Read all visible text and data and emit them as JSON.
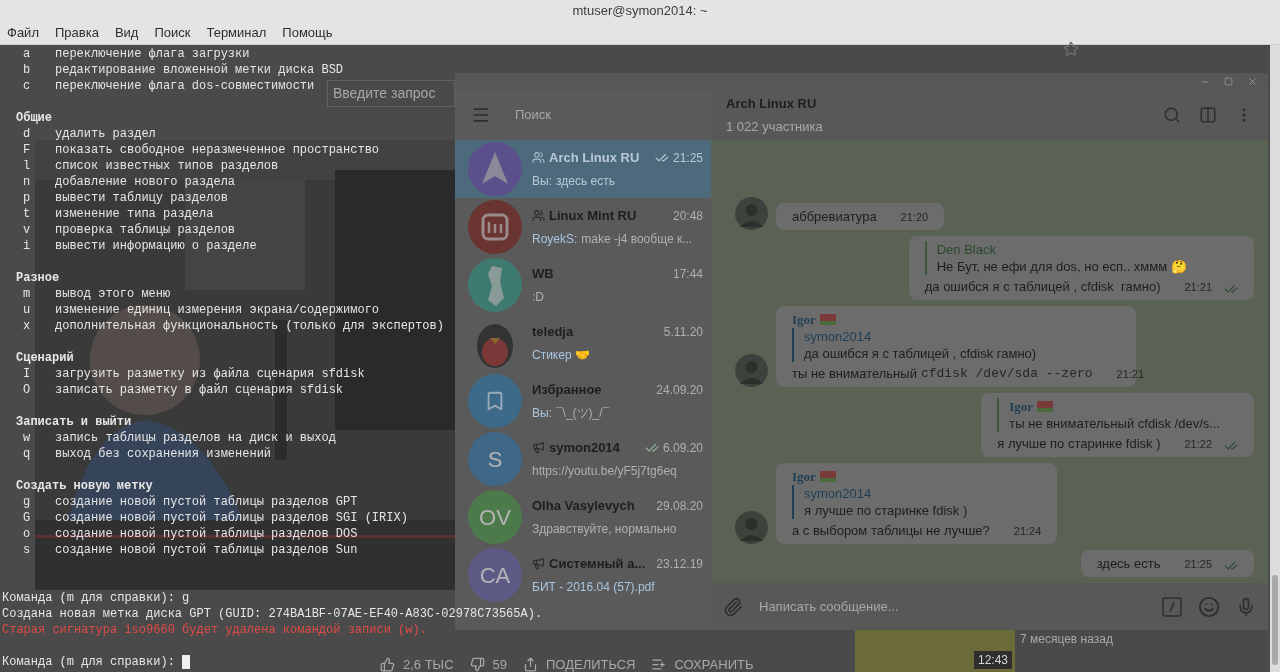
{
  "window": {
    "title": "mtuser@symon2014: ~"
  },
  "menu": [
    "Файл",
    "Правка",
    "Вид",
    "Поиск",
    "Терминал",
    "Помощь"
  ],
  "browser": {
    "search_placeholder": "Введите запрос",
    "actions": [
      {
        "kind": "like",
        "label": "2,6 ТЫС"
      },
      {
        "kind": "dislike",
        "label": "59"
      },
      {
        "kind": "share",
        "label": "ПОДЕЛИТЬСЯ"
      },
      {
        "kind": "save",
        "label": "СОХРАНИТЬ"
      }
    ],
    "thumb_duration": "12:43",
    "thumb_age": "7 месяцев назад"
  },
  "telegram": {
    "search_placeholder": "Поиск",
    "chats": [
      {
        "kind": "group",
        "name": "Arch Linux RU",
        "time": "21:25",
        "read": true,
        "prefix": "Вы:",
        "preview": "здесь есть",
        "selected": true,
        "avatar": {
          "kind": "arch",
          "color": "#5b4f8c"
        }
      },
      {
        "kind": "group",
        "name": "Linux Mint RU",
        "time": "20:48",
        "prefix": "RoyekS:",
        "preview": "make -j4 вообще к...",
        "selected": false,
        "avatar": {
          "kind": "mint",
          "color": "#6a3430"
        }
      },
      {
        "kind": "private",
        "name": "WB",
        "time": "17:44",
        "preview": ":D",
        "selected": false,
        "avatar": {
          "kind": "map",
          "color": "#3f7a70"
        }
      },
      {
        "kind": "private",
        "name": "teledja",
        "time": "5.11.20",
        "preview": "Стикер 🤝",
        "accent": true,
        "selected": false,
        "avatar": {
          "kind": "penguin",
          "color": "#7a3838"
        }
      },
      {
        "kind": "private",
        "name": "Избранное",
        "time": "24.09.20",
        "prefix": "Вы:",
        "preview": "¯\\_(ツ)_/¯",
        "selected": false,
        "avatar": {
          "kind": "bookmark",
          "color": "#3e6a8a"
        }
      },
      {
        "kind": "channel",
        "name": "symon2014",
        "time": "6.09.20",
        "read": true,
        "preview": "https://youtu.be/yF5j7tg6eq",
        "selected": false,
        "avatar": {
          "kind": "initials",
          "text": "S",
          "color": "#3f6788"
        }
      },
      {
        "kind": "private",
        "name": "Olha Vasylevych",
        "time": "29.08.20",
        "preview": "Здравствуйте, нормально",
        "selected": false,
        "avatar": {
          "kind": "initials",
          "text": "OV",
          "color": "#4d7a4a"
        }
      },
      {
        "kind": "channel",
        "name": "Системный а...",
        "time": "23.12.19",
        "preview": "БИТ - 2016.04 (57).pdf",
        "accent": true,
        "selected": false,
        "avatar": {
          "kind": "initials",
          "text": "CA",
          "color": "#5e5a86"
        }
      }
    ],
    "chat": {
      "title": "Arch Linux RU",
      "subtitle": "1 022 участника",
      "input_placeholder": "Написать сообщение...",
      "messages": [
        {
          "kind": "in",
          "text": "аббревиатура",
          "time": "21:20",
          "avatar": true
        },
        {
          "kind": "out",
          "reply": {
            "author": "Den Black",
            "text": "Не Бут, не ефи для dos, но есп.. хммм 🤔"
          },
          "text": "да ошибся я с таблицей , cfdisk  гамно)",
          "time": "21:21",
          "read": true
        },
        {
          "kind": "in",
          "sender": "Igor",
          "flag": true,
          "reply": {
            "author": "symon2014",
            "text": "да ошибся я с таблицей , cfdisk  гамно)"
          },
          "text": "ты не внимательный",
          "code": "cfdisk /dev/sda --zero",
          "time": "21:21",
          "avatar": true
        },
        {
          "kind": "out",
          "reply": {
            "author": "Igor",
            "flag": true,
            "text": "ты не внимательный cfdisk /dev/s..."
          },
          "text": "я лучше по старинке fdisk )",
          "time": "21:22",
          "read": true
        },
        {
          "kind": "in",
          "sender": "Igor",
          "flag": true,
          "reply": {
            "author": "symon2014",
            "text": "я лучше по старинке fdisk )"
          },
          "text": "а с выбором таблицы не лучше?",
          "time": "21:24",
          "avatar": true
        },
        {
          "kind": "out",
          "text": "здесь есть",
          "time": "21:25",
          "read": true
        }
      ]
    }
  },
  "terminal": {
    "sections": [
      {
        "items": [
          {
            "key": "a",
            "text": "переключение флага загрузки"
          },
          {
            "key": "b",
            "text": "редактирование вложенной метки диска BSD"
          },
          {
            "key": "c",
            "text": "переключение флага dos-совместимости"
          }
        ]
      },
      {
        "heading": "Общие",
        "items": [
          {
            "key": "d",
            "text": "удалить раздел"
          },
          {
            "key": "F",
            "text": "показать свободное неразмеченное пространство"
          },
          {
            "key": "l",
            "text": "список известных типов разделов"
          },
          {
            "key": "n",
            "text": "добавление нового раздела"
          },
          {
            "key": "p",
            "text": "вывести таблицу разделов"
          },
          {
            "key": "t",
            "text": "изменение типа раздела"
          },
          {
            "key": "v",
            "text": "проверка таблицы разделов"
          },
          {
            "key": "i",
            "text": "вывести информацию о разделе"
          }
        ]
      },
      {
        "heading": "Разное",
        "items": [
          {
            "key": "m",
            "text": "вывод этого меню"
          },
          {
            "key": "u",
            "text": "изменение единиц измерения экрана/содержимого"
          },
          {
            "key": "x",
            "text": "дополнительная функциональность (только для экспертов)"
          }
        ]
      },
      {
        "heading": "Сценарий",
        "items": [
          {
            "key": "I",
            "text": "загрузить разметку из файла сценария sfdisk"
          },
          {
            "key": "O",
            "text": "записать разметку в файл сценария sfdisk"
          }
        ]
      },
      {
        "heading": "Записать и выйти",
        "items": [
          {
            "key": "w",
            "text": "запись таблицы разделов на диск и выход"
          },
          {
            "key": "q",
            "text": "выход без сохранения изменений"
          }
        ]
      },
      {
        "heading": "Создать новую метку",
        "items": [
          {
            "key": "g",
            "text": "создание новой пустой таблицы разделов GPT"
          },
          {
            "key": "G",
            "text": "создание новой пустой таблицы разделов SGI (IRIX)"
          },
          {
            "key": "o",
            "text": "создание новой пустой таблицы разделов DOS"
          },
          {
            "key": "s",
            "text": "создание новой пустой таблицы разделов Sun"
          }
        ]
      }
    ],
    "output": [
      {
        "kind": "prompt",
        "text": "Команда (m для справки): g"
      },
      {
        "kind": "info",
        "text": "Создана новая метка диска GPT (GUID: 274BA1BF-07AE-EF40-A83C-02978C73565A)."
      },
      {
        "kind": "warning",
        "text": "Старая сигнатура iso9660 будет удалена командой записи (w)."
      },
      {
        "kind": "prompt",
        "text": "Команда (m для справки): ",
        "cursor": true
      }
    ]
  }
}
